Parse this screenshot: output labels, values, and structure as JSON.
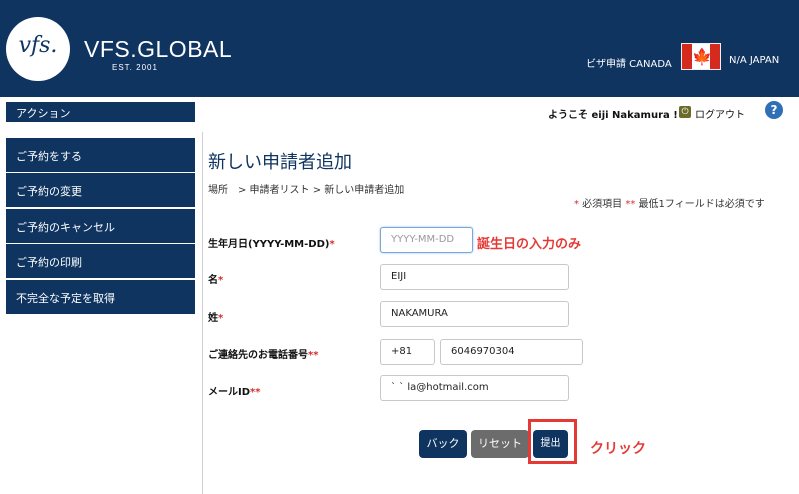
{
  "header": {
    "logo_script": "vfs.",
    "logo_text": "VFS.GLOBAL",
    "logo_est": "EST. 2001",
    "visa_label": "ビザ申請 CANADA",
    "country_label": "N/A JAPAN",
    "flag_icon": "canada-flag-icon",
    "flag_leaf": "🍁"
  },
  "sidebar": {
    "heading": "アクション",
    "items": [
      {
        "label": "ご予約をする"
      },
      {
        "label": "ご予約の変更"
      },
      {
        "label": "ご予約のキャンセル"
      },
      {
        "label": "ご予約の印刷"
      },
      {
        "label": "不完全な予定を取得"
      }
    ]
  },
  "user": {
    "welcome": "ようこそ eiji Nakamura !",
    "logout": "ログアウト",
    "help": "?"
  },
  "page": {
    "title": "新しい申請者追加",
    "breadcrumb": "場所　>  申請者リスト  >  新しい申請者追加",
    "required_note_star": "*",
    "required_note_text": " 必須項目 ",
    "required_note_stars2": "**",
    "required_note_text2": " 最低1フィールドは必須です"
  },
  "form": {
    "dob_label": "生年月日(YYYY-MM-DD)",
    "dob_placeholder": "YYYY-MM-DD",
    "first_name_label": "名",
    "first_name_value": "EIJI",
    "last_name_label": "姓",
    "last_name_value": "NAKAMURA",
    "phone_label": "ご連絡先のお電話番号",
    "phone_code": "+81",
    "phone_number": "6046970304",
    "email_label": "メールID",
    "email_value": "ˋ         ˋ          la@hotmail.com",
    "star": "*",
    "stars2": "**"
  },
  "buttons": {
    "back": "バック",
    "reset": "リセット",
    "submit": "提出"
  },
  "annotations": {
    "dob_note": "誕生日の入力のみ",
    "click_note": "クリック",
    "accent_color": "#e53935"
  }
}
